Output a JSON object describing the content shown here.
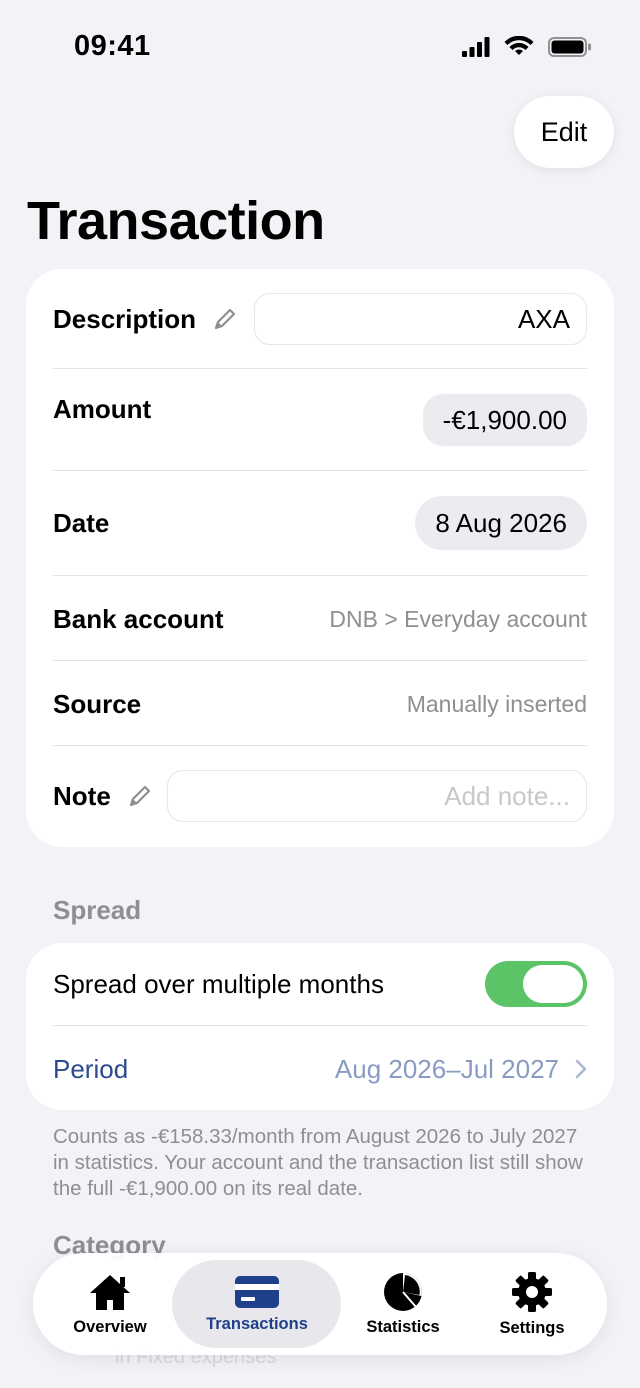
{
  "status_bar": {
    "time": "09:41"
  },
  "header": {
    "edit_label": "Edit",
    "title": "Transaction"
  },
  "details": {
    "description_label": "Description",
    "description_value": "AXA",
    "amount_label": "Amount",
    "amount_value": "-€1,900.00",
    "date_label": "Date",
    "date_value": "8 Aug 2026",
    "bank_account_label": "Bank account",
    "bank_account_value": "DNB > Everyday account",
    "source_label": "Source",
    "source_value": "Manually inserted",
    "note_label": "Note",
    "note_placeholder": "Add note..."
  },
  "spread": {
    "section_title": "Spread",
    "toggle_label": "Spread over multiple months",
    "toggle_on": true,
    "period_label": "Period",
    "period_value": "Aug 2026–Jul 2027",
    "footnote": "Counts as -€158.33/month from August 2026 to July 2027 in statistics. Your account and the transaction list still show the full -€1,900.00 on its real date."
  },
  "category": {
    "section_title": "Category",
    "partial_text": "in Fixed expenses"
  },
  "tabbar": {
    "active": "Transactions",
    "tabs": [
      {
        "label": "Overview",
        "icon": "house-icon"
      },
      {
        "label": "Transactions",
        "icon": "card-icon"
      },
      {
        "label": "Statistics",
        "icon": "pie-chart-icon"
      },
      {
        "label": "Settings",
        "icon": "gear-icon"
      }
    ]
  },
  "colors": {
    "accent": "#1e3f8a",
    "toggle_on": "#5ac466",
    "link": "#2c4a8f"
  }
}
